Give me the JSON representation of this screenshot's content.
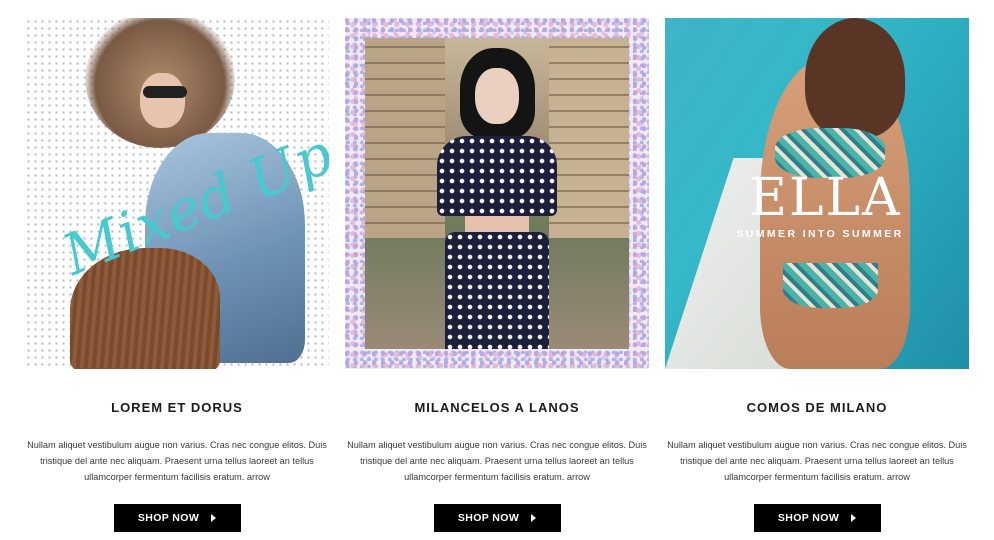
{
  "products": [
    {
      "title": "LOREM ET DORUS",
      "description": "Nullam aliquet vestibulum augue non varius. Cras nec congue elitos. Duis tristique del ante nec aliquam. Praesent urna tellus laoreet an tellus ullamcorper fermentum facilisis eratum. arrow",
      "button_label": "SHOP NOW",
      "image_overlay_text": "Mixed Up!"
    },
    {
      "title": "MILANCELOS A LANOS",
      "description": "Nullam aliquet vestibulum augue non varius. Cras nec congue elitos. Duis tristique del ante nec aliquam. Praesent urna tellus laoreet an tellus ullamcorper fermentum facilisis eratum. arrow",
      "button_label": "SHOP NOW"
    },
    {
      "title": "COMOS DE MILANO",
      "description": "Nullam aliquet vestibulum augue non varius. Cras nec congue elitos. Duis tristique del ante nec aliquam. Praesent urna tellus laoreet an tellus ullamcorper fermentum facilisis eratum. arrow",
      "button_label": "SHOP NOW",
      "image_overlay_title": "ELLA",
      "image_overlay_subtitle": "SUMMER INTO SUMMER"
    }
  ],
  "colors": {
    "button_background": "#000000",
    "button_text": "#ffffff",
    "script_accent": "#47c9cf",
    "pool": "#35b8c8"
  },
  "icons": {
    "button_arrow": "caret-right-icon"
  }
}
